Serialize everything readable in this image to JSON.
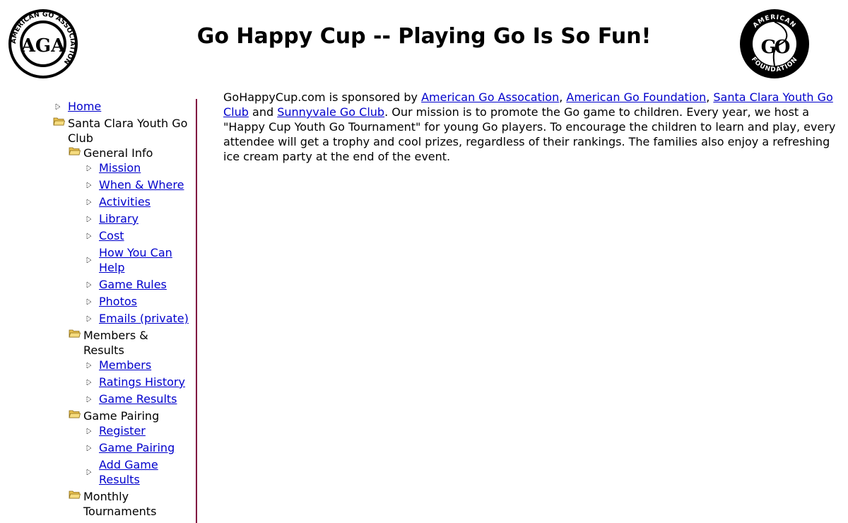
{
  "header": {
    "title": "Go Happy Cup -- Playing Go Is So Fun!",
    "left_logo": {
      "text": "AMERICAN GO ASSOCIATION",
      "monogram": "AGA",
      "icon": "aga-logo"
    },
    "right_logo": {
      "text_top": "AMERICAN",
      "text_bottom": "FOUNDATION",
      "monogram": "GO",
      "icon": "agf-logo"
    }
  },
  "sidebar": {
    "home": "Home",
    "club": "Santa Clara Youth Go Club",
    "general_info": {
      "label": "General Info",
      "items": [
        "Mission",
        "When & Where",
        "Activities",
        "Library",
        "Cost",
        "How You Can Help",
        "Game Rules",
        "Photos",
        "Emails (private)"
      ]
    },
    "members_results": {
      "label": "Members & Results",
      "items": [
        "Members",
        "Ratings History",
        "Game Results"
      ]
    },
    "game_pairing": {
      "label": "Game Pairing",
      "items": [
        "Register",
        "Game Pairing",
        "Add Game Results"
      ]
    },
    "monthly": {
      "label": "Monthly Tournaments"
    }
  },
  "content": {
    "intro": "GoHappyCup.com is sponsored by ",
    "link_aga": "American Go Assocation",
    "sep1": ", ",
    "link_agf": "American Go Foundation",
    "sep2": ", ",
    "link_scygc": "Santa Clara Youth Go Club",
    "sep3": " and ",
    "link_svgc": "Sunnyvale Go Club",
    "body": ". Our mission is to promote the Go game to children. Every year, we host a \"Happy Cup Youth Go Tournament\" for young Go players. To encourage the children to learn and play, every attendee will get a trophy and cool prizes, regardless of their rankings. The families also enjoy a refreshing ice cream party at the end of the event."
  },
  "colors": {
    "link": "#0000cc",
    "divider": "#800040",
    "folder": "#e8c050"
  }
}
